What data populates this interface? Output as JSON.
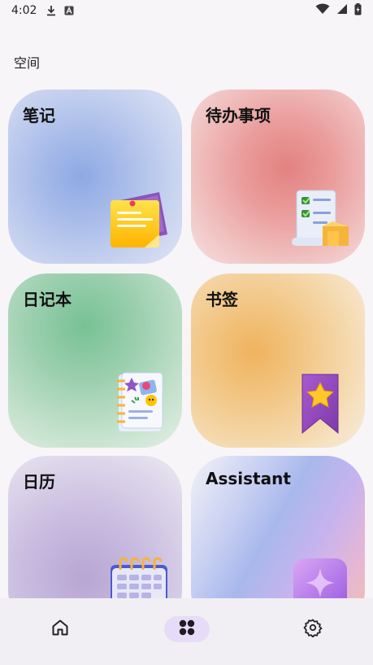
{
  "status_bar": {
    "time": "4:02",
    "icons_left": [
      "download-icon",
      "font-icon"
    ],
    "icons_right": [
      "wifi-icon",
      "cellular-icon",
      "battery-icon"
    ]
  },
  "section": {
    "title": "空间"
  },
  "cards": [
    {
      "label": "笔记",
      "icon": "sticky-note-icon",
      "color": "#8ea9e3"
    },
    {
      "label": "待办事项",
      "icon": "checklist-icon",
      "color": "#e38281"
    },
    {
      "label": "日记本",
      "icon": "diary-icon",
      "color": "#77c195"
    },
    {
      "label": "书签",
      "icon": "bookmark-icon",
      "color": "#efb35d"
    },
    {
      "label": "日历",
      "icon": "calendar-icon",
      "color": "#b8a6d3"
    },
    {
      "label": "Assistant",
      "icon": "sparkle-icon",
      "color": "#a8b8ec"
    }
  ],
  "bottom_nav": {
    "items": [
      {
        "icon": "home-icon",
        "selected": false
      },
      {
        "icon": "apps-grid-icon",
        "selected": true
      },
      {
        "icon": "gear-icon",
        "selected": false
      }
    ],
    "accent": "#e7dcf7"
  }
}
